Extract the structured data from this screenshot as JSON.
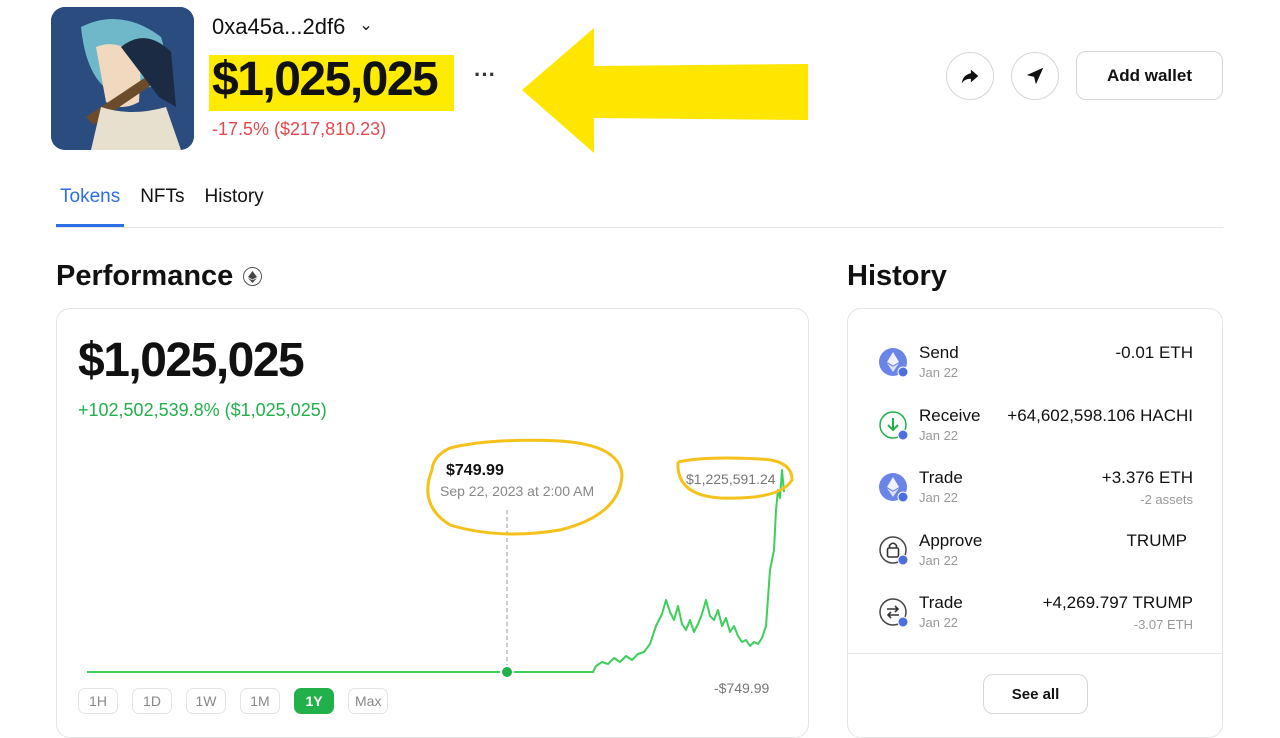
{
  "header": {
    "address": "0xa45a...2df6",
    "balance": "$1,025,025",
    "more": "···",
    "change": "-17.5% ($217,810.23)",
    "add_wallet": "Add wallet"
  },
  "tabs": [
    {
      "label": "Tokens",
      "active": true
    },
    {
      "label": "NFTs",
      "active": false
    },
    {
      "label": "History",
      "active": false
    }
  ],
  "performance": {
    "title": "Performance",
    "value": "$1,025,025",
    "change": "+102,502,539.8% ($1,025,025)",
    "tooltip_price": "$749.99",
    "tooltip_date": "Sep 22, 2023 at 2:00 AM",
    "max_label": "$1,225,591.24",
    "min_label": "-$749.99",
    "ranges": [
      {
        "label": "1H",
        "active": false
      },
      {
        "label": "1D",
        "active": false
      },
      {
        "label": "1W",
        "active": false
      },
      {
        "label": "1M",
        "active": false
      },
      {
        "label": "1Y",
        "active": true
      },
      {
        "label": "Max",
        "active": false
      }
    ]
  },
  "history": {
    "title": "History",
    "items": [
      {
        "type": "Send",
        "date": "Jan 22",
        "amount": "-0.01 ETH",
        "sub": "",
        "icon": "eth-icon"
      },
      {
        "type": "Receive",
        "date": "Jan 22",
        "amount": "+64,602,598.106 HACHI",
        "sub": "",
        "icon": "receive-icon"
      },
      {
        "type": "Trade",
        "date": "Jan 22",
        "amount": "+3.376 ETH",
        "sub": "-2 assets",
        "icon": "eth-icon"
      },
      {
        "type": "Approve",
        "date": "Jan 22",
        "amount": "TRUMP",
        "sub": "",
        "icon": "lock-icon"
      },
      {
        "type": "Trade",
        "date": "Jan 22",
        "amount": "+4,269.797 TRUMP",
        "sub": "-3.07 ETH",
        "icon": "swap-icon"
      }
    ],
    "see_all": "See all"
  },
  "colors": {
    "accent_blue": "#2e6ee6",
    "positive_green": "#22b04a",
    "negative_red": "#e5484d",
    "highlight_yellow": "#ffeb00",
    "annotation_orange": "#f4c21b"
  }
}
